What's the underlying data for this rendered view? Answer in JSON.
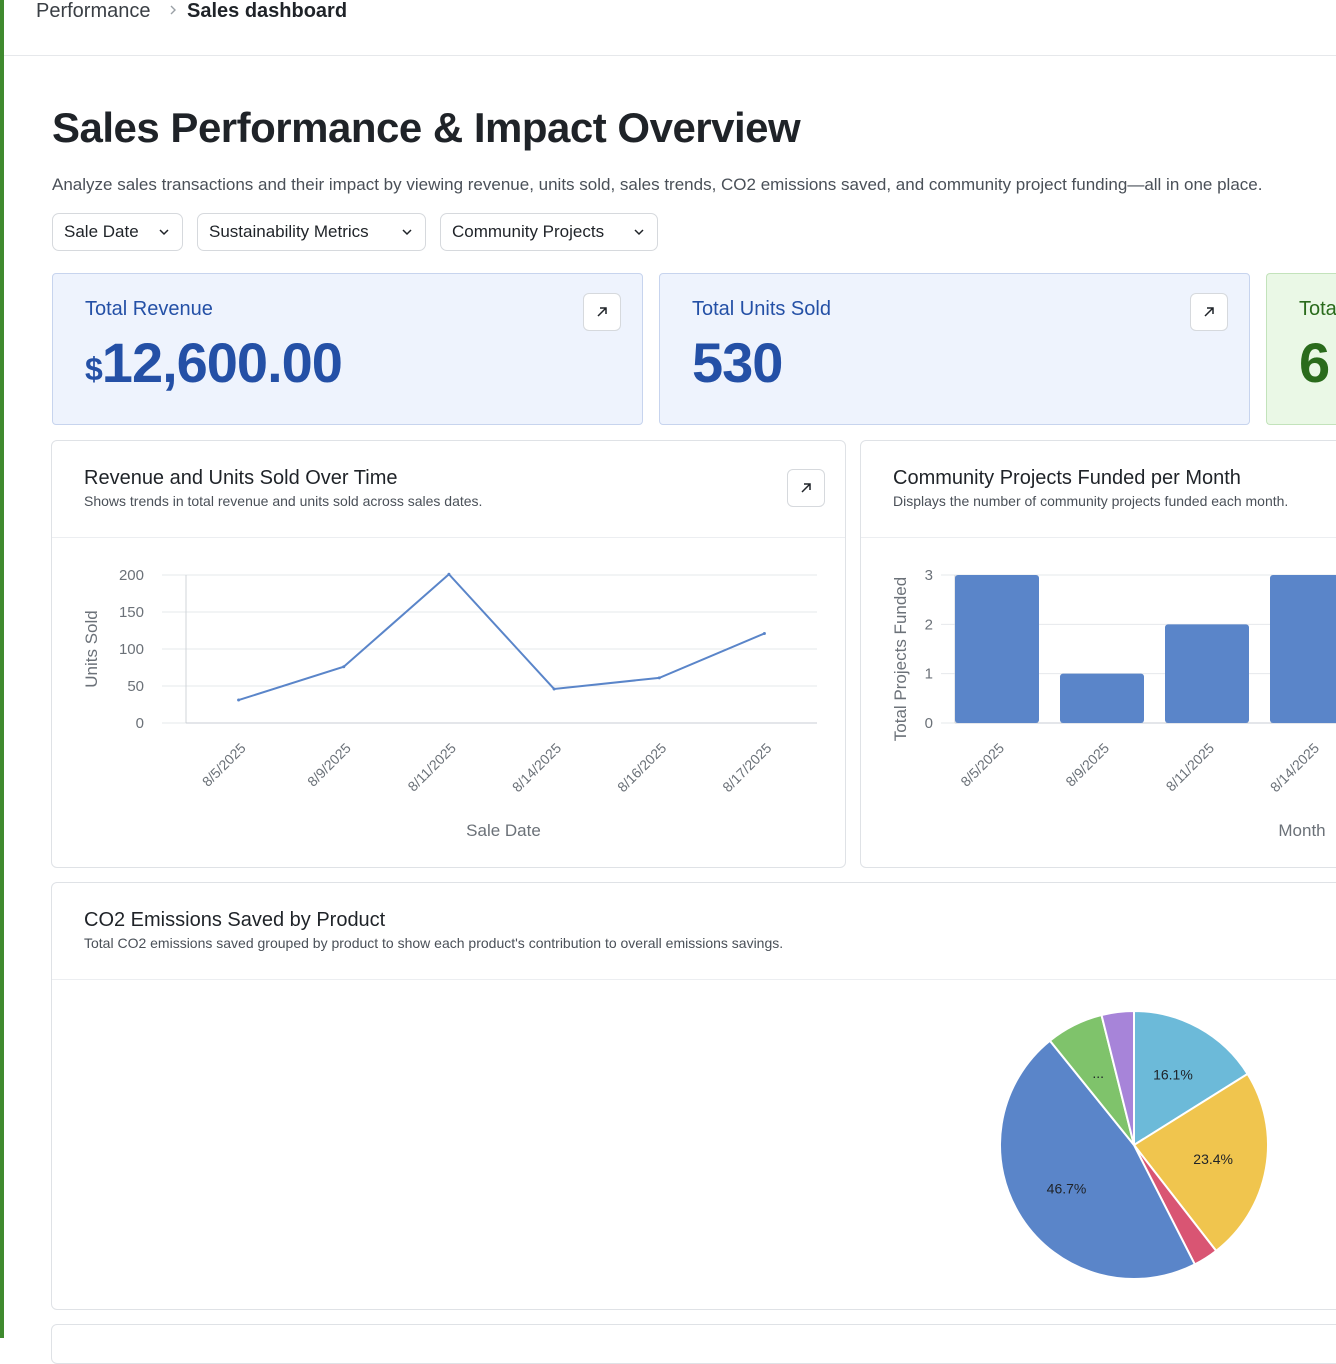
{
  "breadcrumb": {
    "parent": "Performance",
    "current": "Sales dashboard"
  },
  "header": {
    "title": "Sales Performance & Impact Overview",
    "description": "Analyze sales transactions and their impact by viewing revenue, units sold, sales trends, CO2 emissions saved, and community project funding—all in one place."
  },
  "filters": [
    "Sale Date",
    "Sustainability Metrics",
    "Community Projects"
  ],
  "kpis": [
    {
      "label": "Total Revenue",
      "currency": "$",
      "value": "12,600.00"
    },
    {
      "label": "Total Units Sold",
      "value": "530"
    },
    {
      "label": "Tota",
      "value": "6"
    }
  ],
  "colors": {
    "accent_blue": "#2450a6",
    "green": "#2a6b1c",
    "series": "#5a85c9"
  },
  "icons": {
    "open": "arrow-up-right-icon",
    "dropdown": "chevron-down-icon",
    "breadcrumb_sep": "chevron-right-icon"
  },
  "cards": {
    "line": {
      "title": "Revenue and Units Sold Over Time",
      "subtitle": "Shows trends in total revenue and units sold across sales dates."
    },
    "bar": {
      "title": "Community Projects Funded per Month",
      "subtitle": "Displays the number of community projects funded each month."
    },
    "pie": {
      "title": "CO2 Emissions Saved by Product",
      "subtitle": "Total CO2 emissions saved grouped by product to show each product's contribution to overall emissions savings."
    }
  },
  "chart_data": [
    {
      "type": "line",
      "x": [
        "8/5/2025",
        "8/9/2025",
        "8/11/2025",
        "8/14/2025",
        "8/16/2025",
        "8/17/2025"
      ],
      "values": [
        31,
        76,
        201,
        46,
        61,
        121
      ],
      "xlabel": "Sale Date",
      "ylabel": "Units Sold",
      "ylim": [
        0,
        200
      ],
      "yticks": [
        0,
        50,
        100,
        150,
        200
      ],
      "grid": true,
      "color": "#5a85c9"
    },
    {
      "type": "bar",
      "categories": [
        "8/5/2025",
        "8/9/2025",
        "8/11/2025",
        "8/14/2025"
      ],
      "values": [
        3,
        1,
        2,
        3
      ],
      "xlabel": "Month",
      "ylabel": "Total Projects Funded",
      "ylim": [
        0,
        3
      ],
      "yticks": [
        0,
        1,
        2,
        3
      ],
      "grid": true,
      "color": "#5a85c9"
    },
    {
      "type": "pie",
      "slices": [
        {
          "value": 16.1,
          "label": "16.1%",
          "color": "#6cbad9"
        },
        {
          "value": 23.4,
          "label": "23.4%",
          "color": "#f0c54e"
        },
        {
          "value": 3.0,
          "label": "",
          "color": "#d95573"
        },
        {
          "value": 46.7,
          "label": "46.7%",
          "color": "#5a85c9"
        },
        {
          "value": 6.9,
          "label": "...",
          "color": "#7fc36b"
        },
        {
          "value": 3.9,
          "label": "",
          "color": "#a784d9"
        }
      ]
    }
  ]
}
